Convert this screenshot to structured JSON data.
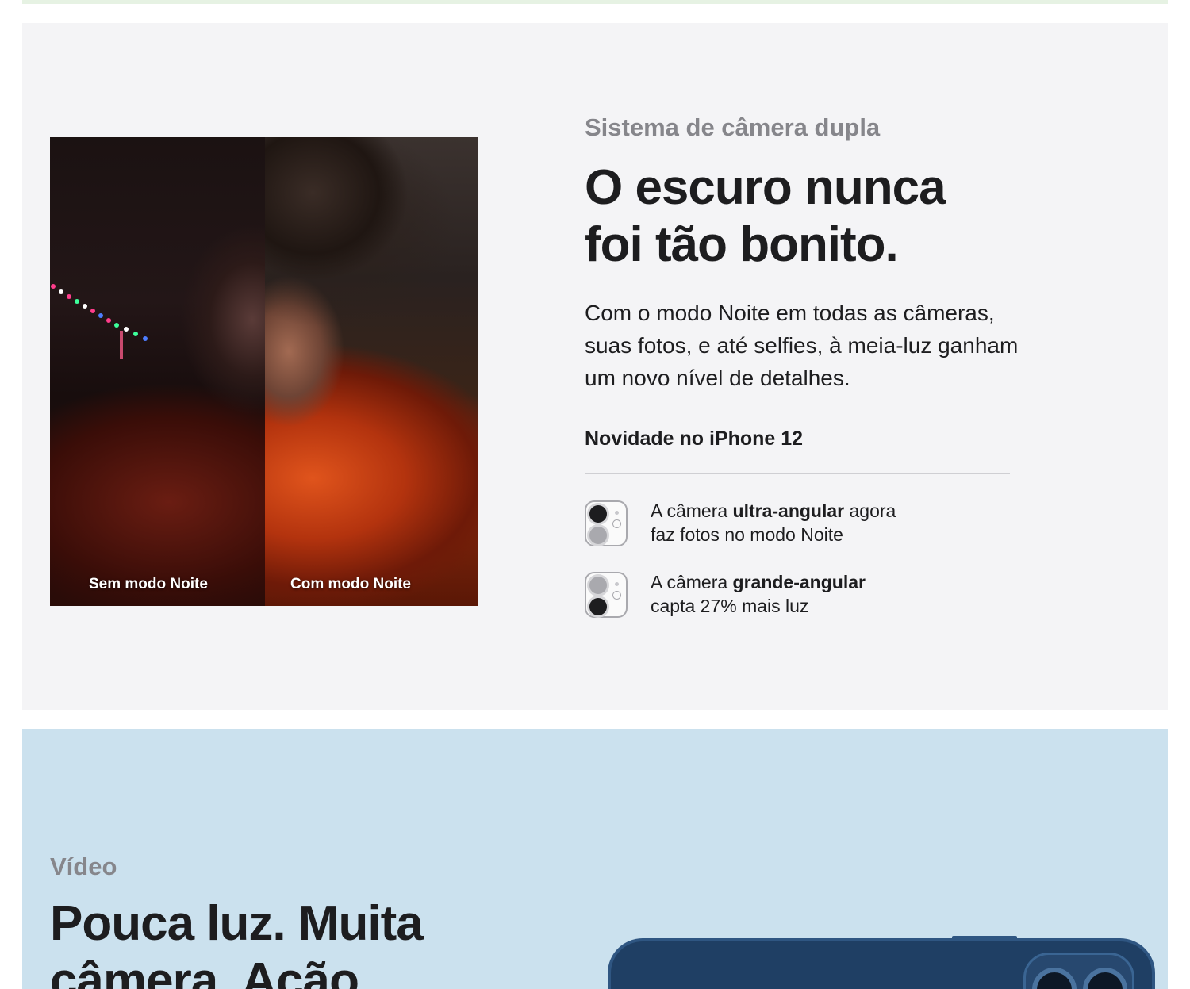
{
  "night_section": {
    "image": {
      "caption_left": "Sem modo Noite",
      "caption_right": "Com modo Noite"
    },
    "eyebrow": "Sistema de câmera dupla",
    "headline_lines": [
      "O escuro nunca",
      "foi tão bonito."
    ],
    "body_lines": [
      "Com o modo Noite em todas as câmeras,",
      "suas fotos, e até selfies, à meia-luz ganham",
      "um novo nível de detalhes."
    ],
    "subhead": "Novidade no iPhone 12",
    "features": [
      {
        "icon": "dual-camera-ultrawide-icon",
        "line1_pre": "A câmera ",
        "line1_bold": "ultra-angular",
        "line1_post": " agora",
        "line2": "faz fotos no modo Noite"
      },
      {
        "icon": "dual-camera-wide-icon",
        "line1_pre": "A câmera ",
        "line1_bold": "grande-angular",
        "line1_post": "",
        "line2": "capta 27% mais luz"
      }
    ]
  },
  "video_section": {
    "eyebrow": "Vídeo",
    "headline_lines": [
      "Pouca luz. Muita",
      "câmera. Ação."
    ]
  },
  "colors": {
    "section_bg": "#f4f4f6",
    "video_bg": "#cbe1ee",
    "eyebrow_gray": "#86868b",
    "text_dark": "#1d1d1f",
    "phone_blue": "#1f3f64"
  }
}
